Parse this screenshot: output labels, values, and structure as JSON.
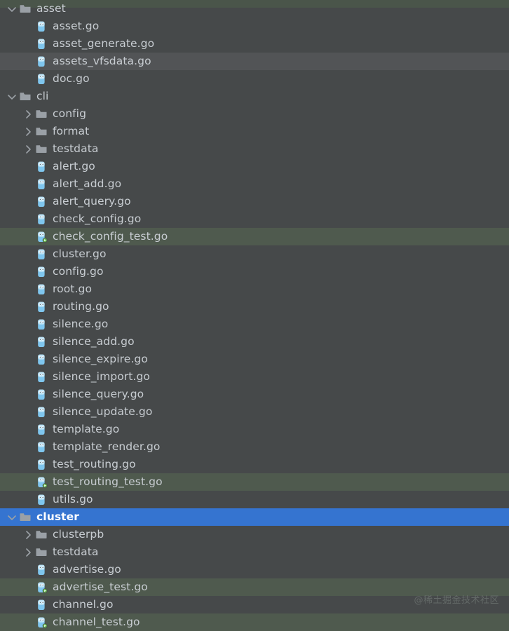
{
  "watermark": "@稀土掘金技术社区",
  "colors": {
    "background": "#46494a",
    "row_highlight_green": "#4f5a4e",
    "row_hover": "#525456",
    "row_selected": "#3574d0",
    "text": "#c8cdd2",
    "text_selected": "#ffffff",
    "folder_icon": "#9aa0a6",
    "file_icon": "#69b7e8",
    "test_marker": "#6cc04a"
  },
  "tree": {
    "name": "project-file-tree",
    "rows": [
      {
        "label": "asset",
        "type": "folder",
        "depth": 1,
        "expanded": true,
        "state": "none"
      },
      {
        "label": "asset.go",
        "type": "go",
        "depth": 2,
        "state": "none"
      },
      {
        "label": "asset_generate.go",
        "type": "go",
        "depth": 2,
        "state": "none"
      },
      {
        "label": "assets_vfsdata.go",
        "type": "go",
        "depth": 2,
        "state": "hover"
      },
      {
        "label": "doc.go",
        "type": "go",
        "depth": 2,
        "state": "none"
      },
      {
        "label": "cli",
        "type": "folder",
        "depth": 1,
        "expanded": true,
        "state": "none"
      },
      {
        "label": "config",
        "type": "folder",
        "depth": 2,
        "expanded": false,
        "state": "none"
      },
      {
        "label": "format",
        "type": "folder",
        "depth": 2,
        "expanded": false,
        "state": "none"
      },
      {
        "label": "testdata",
        "type": "folder",
        "depth": 2,
        "expanded": false,
        "state": "none"
      },
      {
        "label": "alert.go",
        "type": "go",
        "depth": 2,
        "state": "none"
      },
      {
        "label": "alert_add.go",
        "type": "go",
        "depth": 2,
        "state": "none"
      },
      {
        "label": "alert_query.go",
        "type": "go",
        "depth": 2,
        "state": "none"
      },
      {
        "label": "check_config.go",
        "type": "go",
        "depth": 2,
        "state": "none"
      },
      {
        "label": "check_config_test.go",
        "type": "gotest",
        "depth": 2,
        "state": "green"
      },
      {
        "label": "cluster.go",
        "type": "go",
        "depth": 2,
        "state": "none"
      },
      {
        "label": "config.go",
        "type": "go",
        "depth": 2,
        "state": "none"
      },
      {
        "label": "root.go",
        "type": "go",
        "depth": 2,
        "state": "none"
      },
      {
        "label": "routing.go",
        "type": "go",
        "depth": 2,
        "state": "none"
      },
      {
        "label": "silence.go",
        "type": "go",
        "depth": 2,
        "state": "none"
      },
      {
        "label": "silence_add.go",
        "type": "go",
        "depth": 2,
        "state": "none"
      },
      {
        "label": "silence_expire.go",
        "type": "go",
        "depth": 2,
        "state": "none"
      },
      {
        "label": "silence_import.go",
        "type": "go",
        "depth": 2,
        "state": "none"
      },
      {
        "label": "silence_query.go",
        "type": "go",
        "depth": 2,
        "state": "none"
      },
      {
        "label": "silence_update.go",
        "type": "go",
        "depth": 2,
        "state": "none"
      },
      {
        "label": "template.go",
        "type": "go",
        "depth": 2,
        "state": "none"
      },
      {
        "label": "template_render.go",
        "type": "go",
        "depth": 2,
        "state": "none"
      },
      {
        "label": "test_routing.go",
        "type": "go",
        "depth": 2,
        "state": "none"
      },
      {
        "label": "test_routing_test.go",
        "type": "gotest",
        "depth": 2,
        "state": "green"
      },
      {
        "label": "utils.go",
        "type": "go",
        "depth": 2,
        "state": "none"
      },
      {
        "label": "cluster",
        "type": "folder",
        "depth": 1,
        "expanded": true,
        "state": "selected"
      },
      {
        "label": "clusterpb",
        "type": "folder",
        "depth": 2,
        "expanded": false,
        "state": "none"
      },
      {
        "label": "testdata",
        "type": "folder",
        "depth": 2,
        "expanded": false,
        "state": "none"
      },
      {
        "label": "advertise.go",
        "type": "go",
        "depth": 2,
        "state": "none"
      },
      {
        "label": "advertise_test.go",
        "type": "gotest",
        "depth": 2,
        "state": "green"
      },
      {
        "label": "channel.go",
        "type": "go",
        "depth": 2,
        "state": "none"
      },
      {
        "label": "channel_test.go",
        "type": "gotest",
        "depth": 2,
        "state": "green"
      }
    ]
  }
}
